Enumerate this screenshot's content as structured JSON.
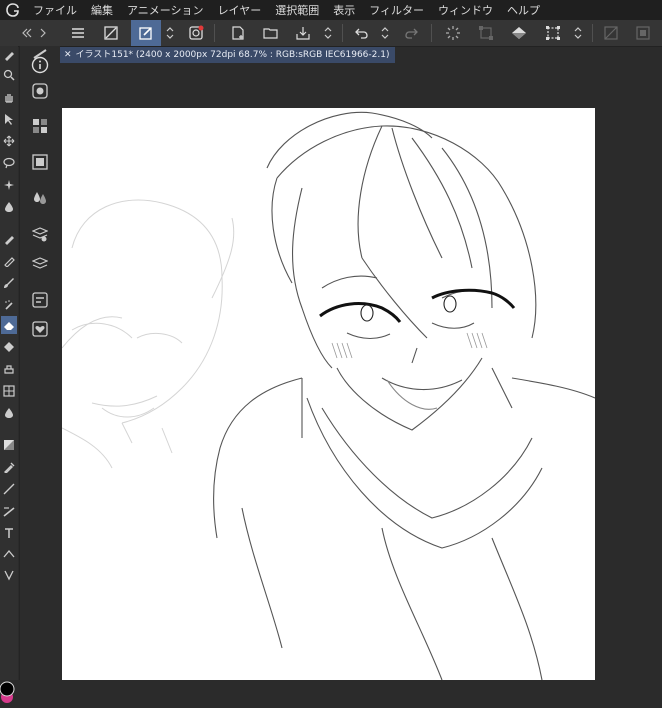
{
  "menu": {
    "items": [
      "ファイル",
      "編集",
      "アニメーション",
      "レイヤー",
      "選択範囲",
      "表示",
      "フィルター",
      "ウィンドウ",
      "ヘルプ"
    ]
  },
  "document": {
    "tab_label": "イラスト151* (2400 x 2000px 72dpi 68.7% : RGB:sRGB IEC61966-2.1)"
  },
  "colors": {
    "accent_active": "#4e6a96",
    "main_color": "#000000",
    "sub_color": "#d63a8c"
  },
  "icons": {
    "toolbar": [
      "menu-icon",
      "canvas-toggle-icon",
      "edit-layer-icon",
      "chevron-updown-icon",
      "companion-icon",
      "new-file-icon",
      "open-file-icon",
      "save-icon",
      "chevron-updown-icon",
      "undo-icon",
      "chevron-updown-icon",
      "redo-icon",
      "loading-icon",
      "transform-icon",
      "fill-icon",
      "select-all-icon",
      "chevron-updown-icon",
      "deselect-icon"
    ]
  }
}
